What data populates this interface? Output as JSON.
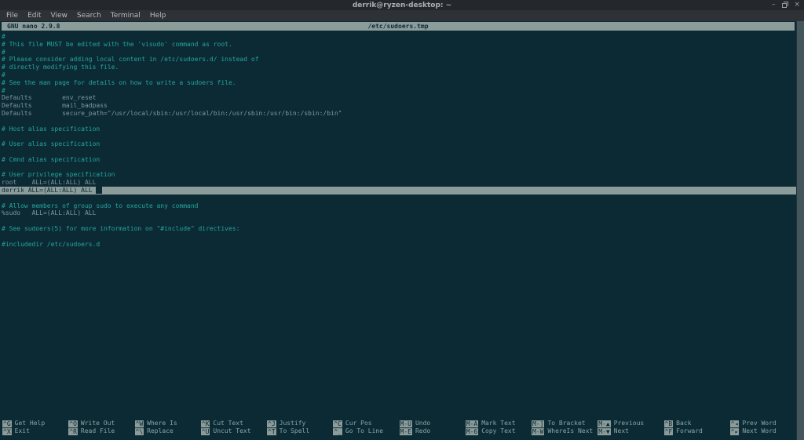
{
  "colors": {
    "term-bg": "#0c2a34",
    "titlebar-bg": "#24282c",
    "menubar-bg": "#2e3236",
    "bar-bg": "#8b9c9a",
    "bar-fg": "#0c2a34",
    "text-plain": "#7e959e",
    "text-comment": "#24a59d",
    "cursor": "#0c2a34",
    "help-label": "#87a5a9",
    "scrollbar": "#44565c"
  },
  "window": {
    "title": "derrik@ryzen-desktop: ~",
    "minimize_glyph": "–",
    "close_glyph": "×"
  },
  "menubar": {
    "items": [
      "File",
      "Edit",
      "View",
      "Search",
      "Terminal",
      "Help"
    ]
  },
  "nano": {
    "version_label": "GNU nano 2.9.8",
    "filename": "/etc/sudoers.tmp",
    "status_message": ""
  },
  "editor": {
    "lines": [
      {
        "t": "#",
        "c": "comment"
      },
      {
        "t": "# This file MUST be edited with the 'visudo' command as root.",
        "c": "comment"
      },
      {
        "t": "#",
        "c": "comment"
      },
      {
        "t": "# Please consider adding local content in /etc/sudoers.d/ instead of",
        "c": "comment"
      },
      {
        "t": "# directly modifying this file.",
        "c": "comment"
      },
      {
        "t": "#",
        "c": "comment"
      },
      {
        "t": "# See the man page for details on how to write a sudoers file.",
        "c": "comment"
      },
      {
        "t": "#",
        "c": "comment"
      },
      {
        "t": "Defaults        env_reset",
        "c": "plain"
      },
      {
        "t": "Defaults        mail_badpass",
        "c": "plain"
      },
      {
        "t": "Defaults        secure_path=\"/usr/local/sbin:/usr/local/bin:/usr/sbin:/usr/bin:/sbin:/bin\"",
        "c": "plain"
      },
      {
        "t": "",
        "c": "plain"
      },
      {
        "t": "# Host alias specification",
        "c": "comment"
      },
      {
        "t": "",
        "c": "plain"
      },
      {
        "t": "# User alias specification",
        "c": "comment"
      },
      {
        "t": "",
        "c": "plain"
      },
      {
        "t": "# Cmnd alias specification",
        "c": "comment"
      },
      {
        "t": "",
        "c": "plain"
      },
      {
        "t": "# User privilege specification",
        "c": "comment"
      },
      {
        "t": "root    ALL=(ALL:ALL) ALL",
        "c": "plain"
      },
      {
        "t": "derrik ALL=(ALL:ALL) ALL",
        "c": "sel",
        "cursor": true
      },
      {
        "t": "",
        "c": "plain"
      },
      {
        "t": "# Allow members of group sudo to execute any command",
        "c": "comment"
      },
      {
        "t": "%sudo   ALL=(ALL:ALL) ALL",
        "c": "plain"
      },
      {
        "t": "",
        "c": "plain"
      },
      {
        "t": "# See sudoers(5) for more information on \"#include\" directives:",
        "c": "comment"
      },
      {
        "t": "",
        "c": "plain"
      },
      {
        "t": "#includedir /etc/sudoers.d",
        "c": "comment"
      }
    ]
  },
  "help": {
    "columns": [
      {
        "top": {
          "key": "^G",
          "label": "Get Help"
        },
        "bottom": {
          "key": "^X",
          "label": "Exit"
        }
      },
      {
        "top": {
          "key": "^O",
          "label": "Write Out"
        },
        "bottom": {
          "key": "^R",
          "label": "Read File"
        }
      },
      {
        "top": {
          "key": "^W",
          "label": "Where Is"
        },
        "bottom": {
          "key": "^\\",
          "label": "Replace"
        }
      },
      {
        "top": {
          "key": "^K",
          "label": "Cut Text"
        },
        "bottom": {
          "key": "^U",
          "label": "Uncut Text"
        }
      },
      {
        "top": {
          "key": "^J",
          "label": "Justify"
        },
        "bottom": {
          "key": "^T",
          "label": "To Spell"
        }
      },
      {
        "top": {
          "key": "^C",
          "label": "Cur Pos"
        },
        "bottom": {
          "key": "^_",
          "label": "Go To Line"
        }
      },
      {
        "top": {
          "key": "M-U",
          "label": "Undo"
        },
        "bottom": {
          "key": "M-E",
          "label": "Redo"
        }
      },
      {
        "top": {
          "key": "M-A",
          "label": "Mark Text"
        },
        "bottom": {
          "key": "M-6",
          "label": "Copy Text"
        }
      },
      {
        "top": {
          "key": "M-]",
          "label": "To Bracket"
        },
        "bottom": {
          "key": "M-W",
          "label": "WhereIs Next"
        }
      },
      {
        "top": {
          "key": "M-▲",
          "label": "Previous"
        },
        "bottom": {
          "key": "M-▼",
          "label": "Next"
        }
      },
      {
        "top": {
          "key": "^B",
          "label": "Back"
        },
        "bottom": {
          "key": "^F",
          "label": "Forward"
        }
      },
      {
        "top": {
          "key": "^◂",
          "label": "Prev Word"
        },
        "bottom": {
          "key": "^▸",
          "label": "Next Word"
        }
      }
    ]
  }
}
